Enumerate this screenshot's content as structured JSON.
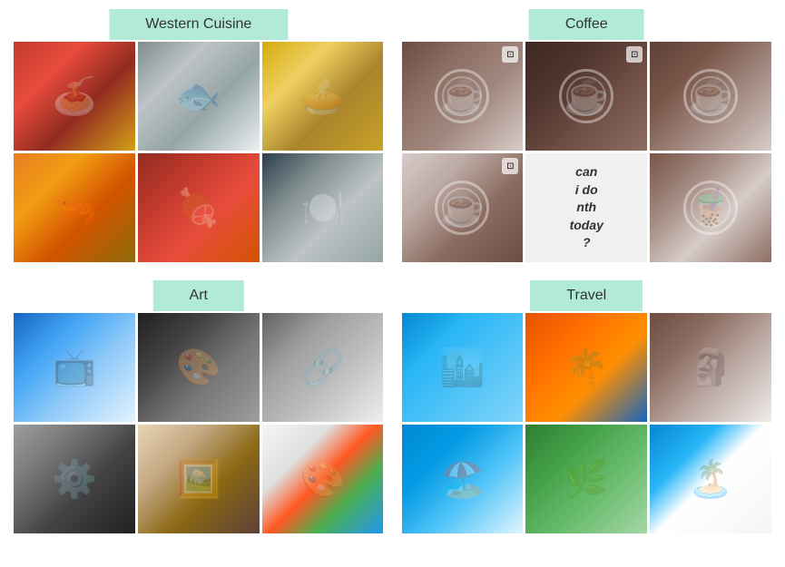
{
  "categories": [
    {
      "id": "western-cuisine",
      "label": "Western Cuisine",
      "images": [
        {
          "id": "wc1",
          "alt": "Spaghetti with tomato sauce",
          "style": "wc-1",
          "icon": "🍝"
        },
        {
          "id": "wc2",
          "alt": "Grilled fish on plate",
          "style": "wc-2",
          "icon": "🐟"
        },
        {
          "id": "wc3",
          "alt": "Chicken pot pie",
          "style": "wc-3",
          "icon": "🥧"
        },
        {
          "id": "wc4",
          "alt": "Stir fried prawns",
          "style": "wc-4",
          "icon": "🦐"
        },
        {
          "id": "wc5",
          "alt": "Braised meat dish",
          "style": "wc-5",
          "icon": "🍖"
        },
        {
          "id": "wc6",
          "alt": "Restaurant interior black white",
          "style": "wc-6",
          "icon": "🍽️"
        }
      ]
    },
    {
      "id": "coffee",
      "label": "Coffee",
      "images": [
        {
          "id": "cf1",
          "alt": "Coffee with camera on table",
          "style": "cf-1",
          "icon": "☕",
          "hasOverlay": true
        },
        {
          "id": "cf2",
          "alt": "Latte art in dark cup",
          "style": "cf-2",
          "icon": "☕",
          "hasOverlay": true
        },
        {
          "id": "cf3",
          "alt": "Cappuccino with leaf art",
          "style": "cf-3",
          "icon": "☕"
        },
        {
          "id": "cf4",
          "alt": "Flat white coffee art",
          "style": "cf-4",
          "icon": "☕",
          "hasOverlay": true
        },
        {
          "id": "cf5",
          "alt": "Can do nothing today poster",
          "style": "cf-5",
          "isText": true,
          "textLines": [
            "can",
            "i",
            "do",
            "nth",
            "today",
            "?"
          ]
        },
        {
          "id": "cf6",
          "alt": "Iced coffee caramel",
          "style": "cf-6",
          "icon": "🧋"
        }
      ]
    },
    {
      "id": "art",
      "label": "Art",
      "images": [
        {
          "id": "art1",
          "alt": "TV wall mosaic",
          "style": "art-1",
          "icon": "📺"
        },
        {
          "id": "art2",
          "alt": "Charcoal portrait mosaic",
          "style": "art-2",
          "icon": "🎨"
        },
        {
          "id": "art3",
          "alt": "Metal carabiner on gray",
          "style": "art-3",
          "icon": "🔗"
        },
        {
          "id": "art4",
          "alt": "Industrial machinery drawing",
          "style": "art-4",
          "icon": "⚙️"
        },
        {
          "id": "art5",
          "alt": "Painting of people",
          "style": "art-5",
          "icon": "🖼️"
        },
        {
          "id": "art6",
          "alt": "Gallery wall with colorful artwork",
          "style": "art-6",
          "icon": "🎨"
        }
      ]
    },
    {
      "id": "travel",
      "label": "Travel",
      "images": [
        {
          "id": "tr1",
          "alt": "Marina Bay Sands Singapore",
          "style": "tr-1",
          "icon": "🏙️"
        },
        {
          "id": "tr2",
          "alt": "Sunset silhouette palm trees",
          "style": "tr-2",
          "icon": "🌴"
        },
        {
          "id": "tr3",
          "alt": "Stone statue motorbike",
          "style": "tr-3",
          "icon": "🗿"
        },
        {
          "id": "tr4",
          "alt": "Person at beach with chairs",
          "style": "tr-4",
          "icon": "🏖️"
        },
        {
          "id": "tr5",
          "alt": "Green tropical landscape",
          "style": "tr-5",
          "icon": "🌿"
        },
        {
          "id": "tr6",
          "alt": "Tropical beach white sand",
          "style": "tr-6",
          "icon": "🏝️"
        }
      ]
    }
  ]
}
